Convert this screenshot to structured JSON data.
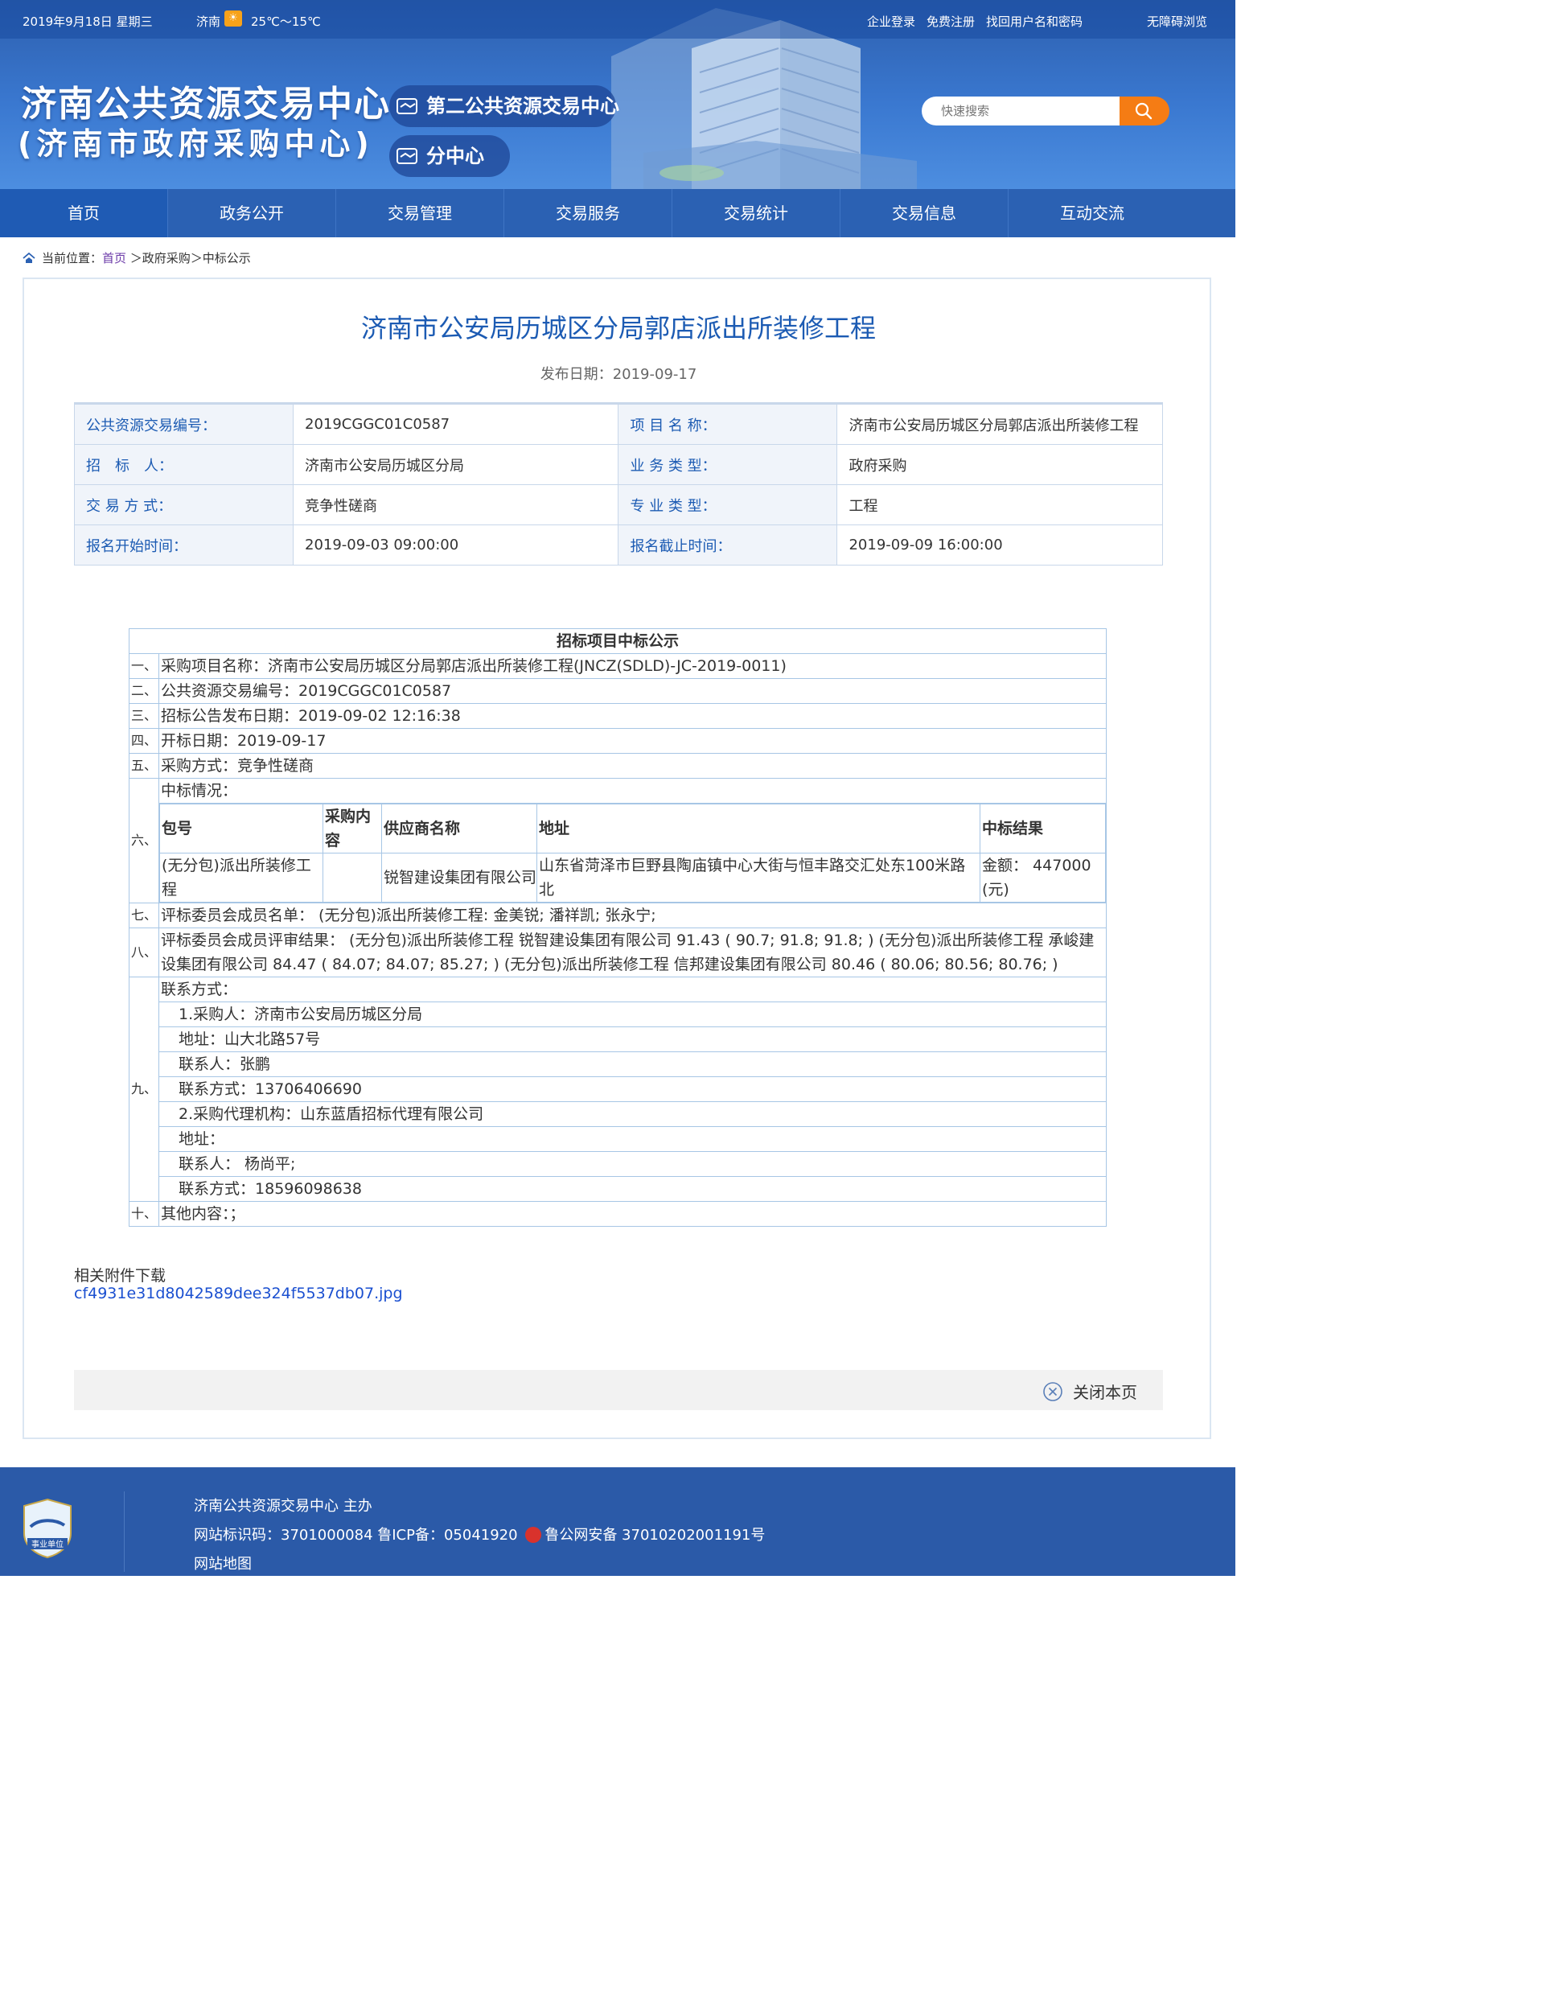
{
  "topbar": {
    "date": "2019年9月18日 星期三",
    "city": "济南",
    "temperature": "25℃～15℃",
    "links": [
      "企业登录",
      "免费注册",
      "找回用户名和密码",
      "无障碍浏览"
    ]
  },
  "header": {
    "logo_title": "济南公共资源交易中心",
    "logo_subtitle": "(济南市政府采购中心)",
    "pill_second": "第二公共资源交易中心",
    "pill_branch": "分中心",
    "search_placeholder": "快速搜索"
  },
  "nav": [
    "首页",
    "政务公开",
    "交易管理",
    "交易服务",
    "交易统计",
    "交易信息",
    "互动交流"
  ],
  "breadcrumb": {
    "prefix": "当前位置：",
    "home": "首页",
    "rest": " ＞政府采购＞中标公示"
  },
  "article": {
    "title": "济南市公安局历城区分局郭店派出所装修工程",
    "date_label": "发布日期：",
    "date": "2019-09-17"
  },
  "info": [
    {
      "l1": "公共资源交易编号：",
      "v1": "2019CGGC01C0587",
      "l2": "项 目 名 称：",
      "v2": "济南市公安局历城区分局郭店派出所装修工程"
    },
    {
      "l1": "招　标　人：",
      "v1": "济南市公安局历城区分局",
      "l2": "业 务 类 型：",
      "v2": "政府采购"
    },
    {
      "l1": "交 易 方 式：",
      "v1": "竞争性磋商",
      "l2": "专 业 类 型：",
      "v2": "工程"
    },
    {
      "l1": "报名开始时间：",
      "v1": "2019-09-03 09:00:00",
      "l2": "报名截止时间：",
      "v2": "2019-09-09 16:00:00"
    }
  ],
  "notice": {
    "title": "招标项目中标公示",
    "r1": {
      "n": "一、",
      "t": "采购项目名称：济南市公安局历城区分局郭店派出所装修工程(JNCZ(SDLD)-JC-2019-0011)"
    },
    "r2": {
      "n": "二、",
      "t": "公共资源交易编号：2019CGGC01C0587"
    },
    "r3": {
      "n": "三、",
      "t": "招标公告发布日期：2019-09-02 12:16:38"
    },
    "r4": {
      "n": "四、",
      "t": "开标日期：2019-09-17"
    },
    "r5": {
      "n": "五、",
      "t": "采购方式：竞争性磋商"
    },
    "r6": {
      "n": "六、",
      "t": "中标情况：",
      "headers": [
        "包号",
        "采购内容",
        "供应商名称",
        "地址",
        "中标结果"
      ],
      "row": [
        "(无分包)派出所装修工程",
        "",
        "锐智建设集团有限公司",
        "山东省菏泽市巨野县陶庙镇中心大街与恒丰路交汇处东100米路北",
        "金额： 447000 (元)"
      ]
    },
    "r7": {
      "n": "七、",
      "t": "评标委员会成员名单： (无分包)派出所装修工程: 金美锐; 潘祥凯; 张永宁;"
    },
    "r8": {
      "n": "八、",
      "t": "评标委员会成员评审结果： (无分包)派出所装修工程 锐智建设集团有限公司 91.43 ( 90.7; 91.8; 91.8; ) (无分包)派出所装修工程 承峻建设集团有限公司 84.47 ( 84.07; 84.07; 85.27; ) (无分包)派出所装修工程 信邦建设集团有限公司 80.46 ( 80.06; 80.56; 80.76; )"
    },
    "r9": {
      "n": "九、",
      "t": "联系方式：",
      "lines": [
        "1.采购人：济南市公安局历城区分局",
        "地址：山大北路57号",
        "联系人：张鹏",
        "联系方式：13706406690",
        "2.采购代理机构：山东蓝盾招标代理有限公司",
        "地址：",
        "联系人： 杨尚平;",
        "联系方式：18596098638"
      ]
    },
    "r10": {
      "n": "十、",
      "t": "其他内容：；"
    }
  },
  "attachment": {
    "label": "相关附件下载",
    "file": "cf4931e31d8042589dee324f5537db07.jpg"
  },
  "close_label": "关闭本页",
  "footer": {
    "host": "济南公共资源交易中心 主办",
    "site_id_text": "网站标识码：3701000084 鲁ICP备：05041920",
    "police_text": "鲁公网安备 37010202001191号",
    "sitemap": "网站地图",
    "badge_text": "事业单位"
  },
  "colors": {
    "brand_blue": "#2b61b3",
    "title_blue": "#1c5bb3",
    "search_orange": "#f57c14",
    "link_blue": "#1a4fd0"
  }
}
